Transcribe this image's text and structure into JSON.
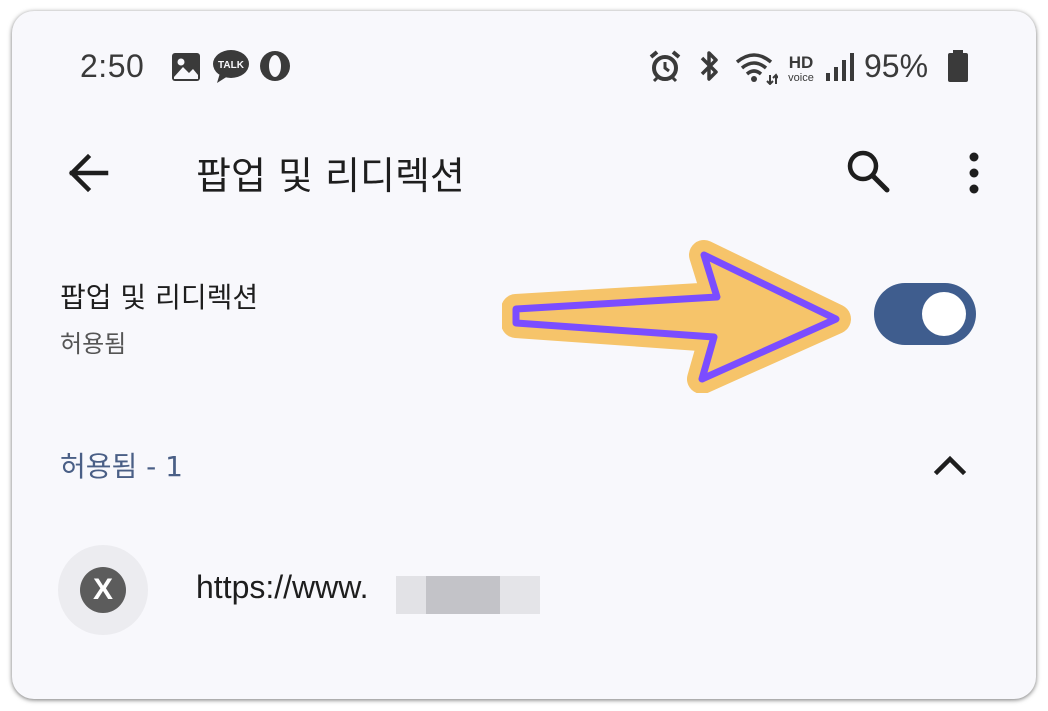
{
  "status_bar": {
    "time": "2:50",
    "battery": "95%",
    "left_icons": [
      "gallery-icon",
      "kakaotalk-icon",
      "opera-icon"
    ],
    "kakao_badge": "TALK",
    "right_icons": [
      "alarm-icon",
      "bluetooth-icon",
      "wifi-icon",
      "hd-voice-icon",
      "signal-icon",
      "battery-icon"
    ],
    "hd_label": "HD",
    "voice_label": "voice"
  },
  "app_bar": {
    "title": "팝업 및 리디렉션",
    "back_icon": "arrow-left-icon",
    "search_icon": "search-icon",
    "more_icon": "more-vert-icon"
  },
  "setting": {
    "title": "팝업 및 리디렉션",
    "subtitle": "허용됨",
    "toggle_on": true,
    "toggle_color": "#3f5d8e"
  },
  "section": {
    "label": "허용됨 - 1",
    "label_color": "#4a5f86",
    "expanded": true
  },
  "sites": [
    {
      "avatar_letter": "X",
      "url": "https://www."
    }
  ],
  "colors": {
    "background": "#f8f8fc",
    "arrow_fill": "#f6c46a",
    "arrow_stroke": "#7b4dff"
  }
}
